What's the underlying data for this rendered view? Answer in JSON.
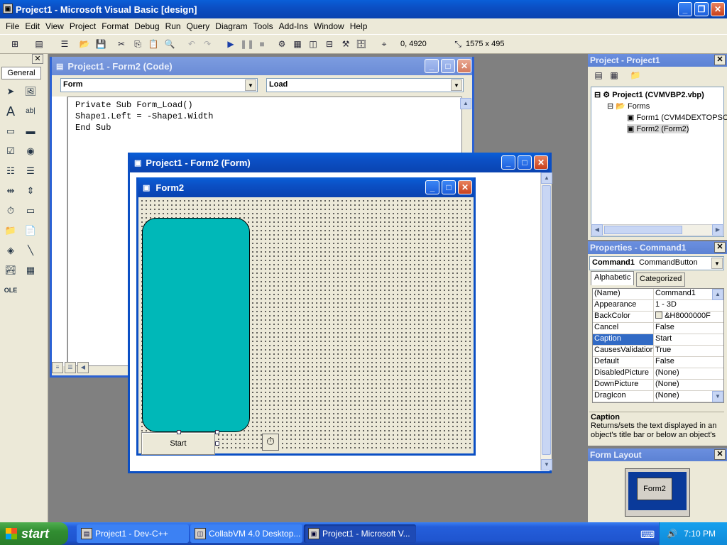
{
  "app": {
    "title": "Project1 - Microsoft Visual Basic [design]"
  },
  "menu": [
    "File",
    "Edit",
    "View",
    "Project",
    "Format",
    "Debug",
    "Run",
    "Query",
    "Diagram",
    "Tools",
    "Add-Ins",
    "Window",
    "Help"
  ],
  "toolbar": {
    "position": "0, 4920",
    "size": "1575 x 495"
  },
  "toolbox": {
    "tab_label": "General"
  },
  "code_window": {
    "title": "Project1 - Form2 (Code)",
    "object_combo": "Form",
    "proc_combo": "Load",
    "lines": [
      "Private Sub Form_Load()",
      "Shape1.Left = -Shape1.Width",
      "End Sub"
    ]
  },
  "form_window": {
    "title": "Project1 - Form2 (Form)",
    "form_caption": "Form2",
    "button_caption": "Start"
  },
  "project_panel": {
    "title": "Project - Project1",
    "project_node": "Project1 (CVMVBP2.vbp)",
    "forms_node": "Forms",
    "form1_node": "Form1 (CVM4DEXTOPSC",
    "form2_node": "Form2 (Form2)"
  },
  "properties_panel": {
    "title": "Properties - Command1",
    "object_name": "Command1",
    "object_type": "CommandButton",
    "tab_alphabetic": "Alphabetic",
    "tab_categorized": "Categorized",
    "rows": [
      {
        "name": "(Name)",
        "value": "Command1"
      },
      {
        "name": "Appearance",
        "value": "1 - 3D"
      },
      {
        "name": "BackColor",
        "value": "&H8000000F"
      },
      {
        "name": "Cancel",
        "value": "False"
      },
      {
        "name": "Caption",
        "value": "Start"
      },
      {
        "name": "CausesValidation",
        "value": "True"
      },
      {
        "name": "Default",
        "value": "False"
      },
      {
        "name": "DisabledPicture",
        "value": "(None)"
      },
      {
        "name": "DownPicture",
        "value": "(None)"
      },
      {
        "name": "DragIcon",
        "value": "(None)"
      }
    ],
    "desc_title": "Caption",
    "desc_text": "Returns/sets the text displayed in an object's title bar or below an object's"
  },
  "layout_panel": {
    "title": "Form Layout",
    "preview_label": "Form2"
  },
  "taskbar": {
    "start_label": "start",
    "tasks": [
      "Project1 - Dev-C++",
      "CollabVM 4.0 Desktop...",
      "Project1 - Microsoft V..."
    ],
    "clock": "7:10 PM"
  },
  "colors": {
    "shape_fill": "#00b8b8",
    "title_active": "#0b4fc4",
    "title_inactive": "#6a8bd6"
  }
}
